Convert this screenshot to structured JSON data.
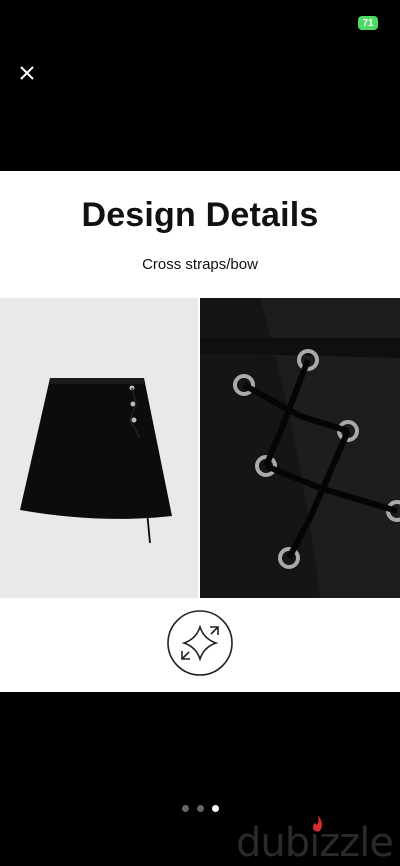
{
  "status_bar": {
    "battery": "71"
  },
  "viewer": {
    "close_icon": "close-icon",
    "page_count": 3,
    "active_page": 3
  },
  "image": {
    "headline": "Design Details",
    "subline": "Cross straps/bow",
    "badge_icon": "sparkle-expand-icon"
  },
  "watermark": {
    "text": "dubizzle",
    "accent": "#d42c2c"
  }
}
